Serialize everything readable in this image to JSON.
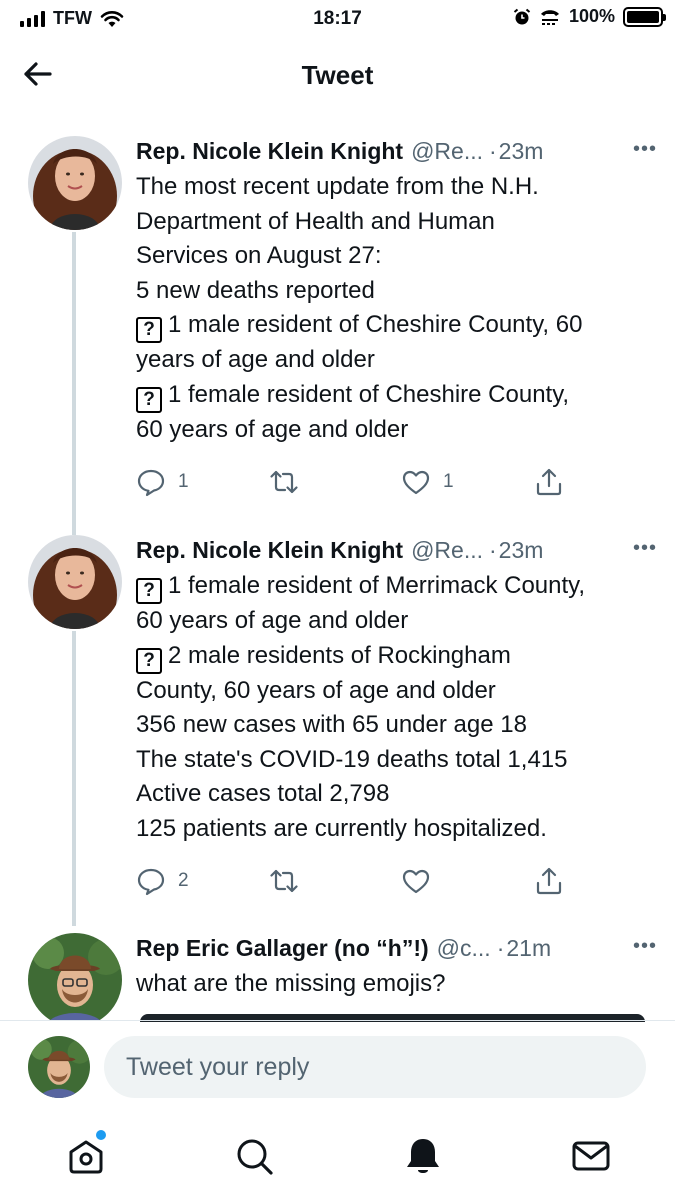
{
  "status_bar": {
    "carrier": "TFW",
    "time": "18:17",
    "battery": "100%"
  },
  "header": {
    "title": "Tweet"
  },
  "tweets": [
    {
      "name": "Rep. Nicole Klein Knight",
      "handle": "@Re...",
      "age": "23m",
      "lines": [
        "The most recent update from the N.H.",
        "Department of Health and Human",
        "Services on August 27:",
        "5 new deaths reported",
        "1 male resident of Cheshire County, 60",
        "years of age and older",
        "1 female resident of Cheshire County,",
        "60 years of age and older"
      ],
      "replies": "1",
      "likes": "1"
    },
    {
      "name": "Rep. Nicole Klein Knight",
      "handle": "@Re...",
      "age": "23m",
      "lines": [
        "1 female resident of Merrimack County,",
        "60 years of age and older",
        "2 male residents of Rockingham",
        "County, 60 years of age and older",
        "356 new cases with 65 under age 18",
        "The state's COVID-19 deaths total 1,415",
        "Active cases total 2,798",
        "125 patients are currently hospitalized."
      ],
      "replies": "2",
      "likes": ""
    },
    {
      "name": "Rep Eric Gallager (no “h”!)",
      "handle": "@c...",
      "age": "21m",
      "lines": [
        "what are the missing emojis?"
      ]
    }
  ],
  "missing_glyph": "?",
  "reply": {
    "placeholder": "Tweet your reply"
  },
  "icons": [
    "back-arrow-icon",
    "more-icon",
    "reply-icon",
    "retweet-icon",
    "like-icon",
    "share-icon",
    "home-icon",
    "search-icon",
    "notifications-icon",
    "messages-icon"
  ],
  "colors": {
    "accent": "#1d9bf0",
    "secondary_text": "#536471",
    "thread_line": "#cfd9de"
  }
}
